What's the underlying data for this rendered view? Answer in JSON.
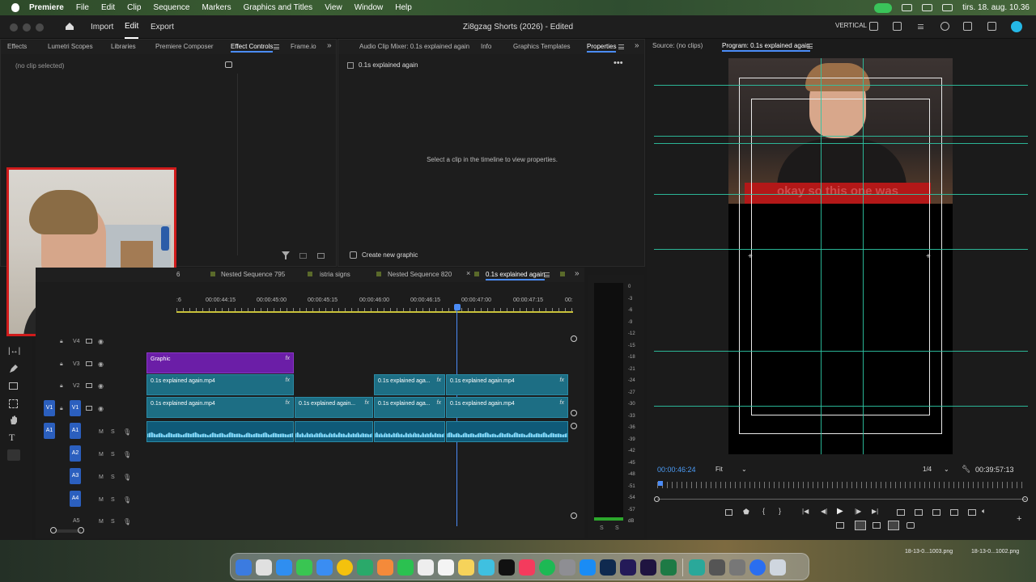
{
  "menubar": {
    "app": "Premiere",
    "items": [
      "File",
      "Edit",
      "Clip",
      "Sequence",
      "Markers",
      "Graphics and Titles",
      "View",
      "Window",
      "Help"
    ],
    "datetime": "tirs. 18. aug. 10.36"
  },
  "header": {
    "nav": [
      "Import",
      "Edit",
      "Export"
    ],
    "active_nav": "Edit",
    "title": "Zi8gzag Shorts (2026) - Edited",
    "layout_label": "VERTICAL"
  },
  "effects_panel": {
    "tabs": [
      "Effects",
      "Lumetri Scopes",
      "Libraries",
      "Premiere Composer",
      "Effect Controls",
      "Frame.io"
    ],
    "active_tab": "Effect Controls",
    "status": "(no clip selected)"
  },
  "properties_panel": {
    "tabs": [
      "Audio Clip Mixer: 0.1s explained again",
      "Info",
      "Graphics Templates",
      "Properties"
    ],
    "active_tab": "Properties",
    "sequence_name": "0.1s explained again",
    "empty_message": "Select a clip in the timeline to view properties.",
    "create_graphic": "Create new graphic"
  },
  "timeline": {
    "tabs": [
      "6",
      "Nested Sequence 795",
      "istria signs",
      "Nested Sequence 820",
      "0.1s explained again"
    ],
    "active_tab": "0.1s explained again",
    "ruler": [
      "00:00:44:15",
      "00:00:45:00",
      "00:00:45:15",
      "00:00:46:00",
      "00:00:46:15",
      "00:00:47:00",
      "00:00:47:15",
      "00:"
    ],
    "video_tracks": [
      "V4",
      "V3",
      "V2",
      "V1"
    ],
    "audio_tracks": [
      "A1",
      "A2",
      "A3",
      "A4",
      "A5"
    ],
    "source_patch_v": "V1",
    "source_patch_a": "A1",
    "clips": {
      "graphic": "Graphic",
      "v2_a": "0.1s explained again.mp4",
      "v2_b": "0.1s explained aga...",
      "v2_c": "0.1s explained again.mp4",
      "v1_a": "0.1s explained again.mp4",
      "v1_b": "0.1s explained again...",
      "v1_c": "0.1s explained aga...",
      "v1_d": "0.1s explained again.mp4"
    },
    "fx": "fx",
    "m": "M",
    "s": "S"
  },
  "meter": {
    "scale": [
      "0",
      "-3",
      "-6",
      "-9",
      "-12",
      "-15",
      "-18",
      "-21",
      "-24",
      "-27",
      "-30",
      "-33",
      "-36",
      "-39",
      "-42",
      "-45",
      "-48",
      "-51",
      "-54",
      "-57",
      "dB"
    ],
    "footer": [
      "S",
      "S"
    ]
  },
  "program": {
    "source_tab": "Source: (no clips)",
    "program_tab": "Program: 0.1s explained again",
    "caption": "okay so this one was",
    "timecode": "00:00:46:24",
    "fit": "Fit",
    "resolution": "1/4",
    "duration": "00:39:57:13"
  },
  "desktop_files": [
    "18-13-0...1003.png",
    "18-13-0...1002.png"
  ]
}
